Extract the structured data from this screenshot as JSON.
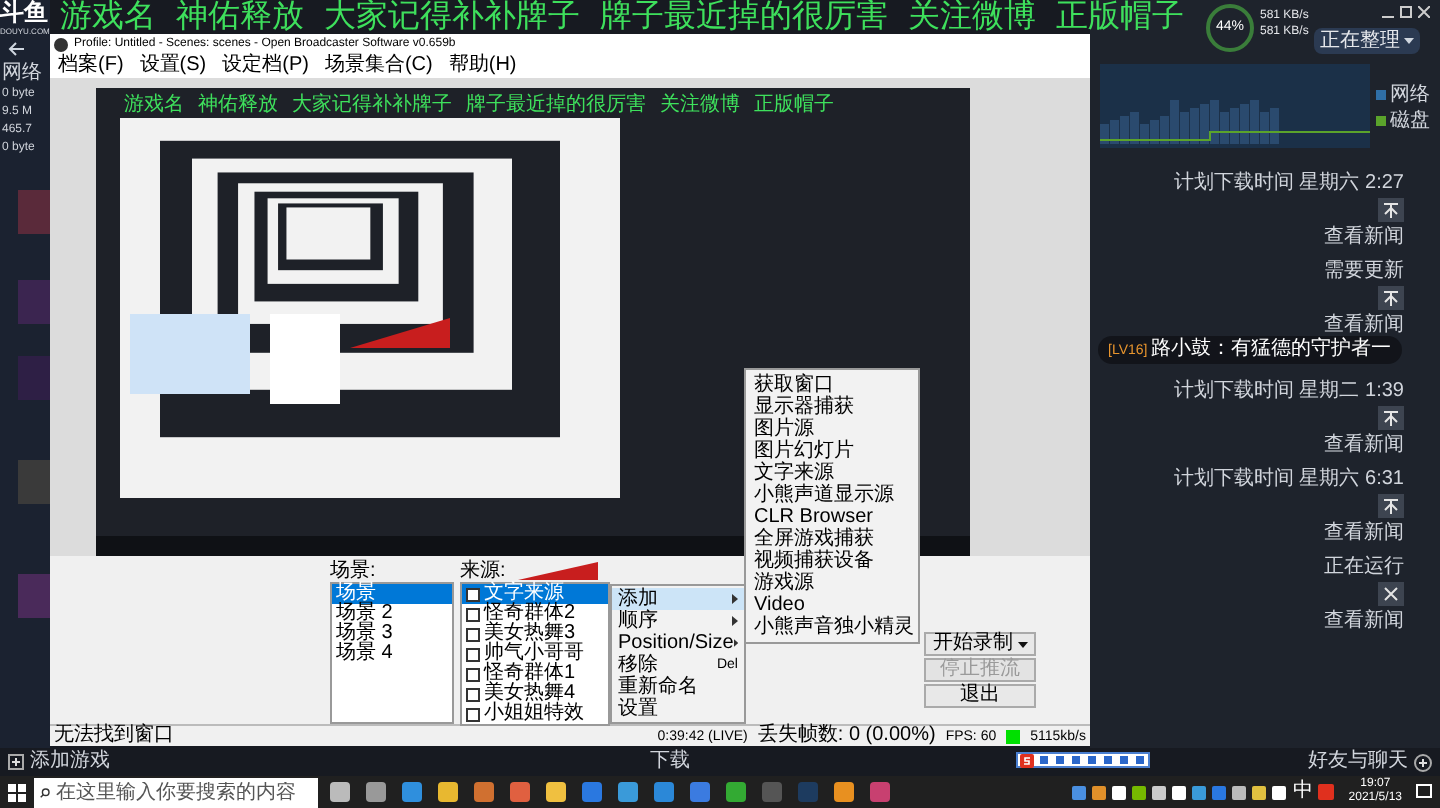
{
  "overlay_lines": [
    {
      "segments": [
        "游戏名",
        "神佑释放",
        "大家记得补补牌子",
        "牌子最近掉的很厉害",
        "关注微博",
        "正版帽子"
      ]
    },
    {
      "segments": [
        "游戏名",
        "神佑释放",
        "大家记得补补牌子",
        "牌子最近掉的很厉害",
        "关注微博",
        "正版帽子"
      ]
    }
  ],
  "steam": {
    "logo": "斗鱼",
    "logo_sub": "DOUYU.COM",
    "stats": [
      "网络",
      "0 byte",
      "9.5 M",
      "465.7",
      "0 byte"
    ],
    "gauge": "44%",
    "rates": [
      "581 KB/s",
      "581 KB/s"
    ],
    "dropdown": "正在整理",
    "legend": [
      {
        "label": "网络",
        "color": "#2f6ea5"
      },
      {
        "label": "磁盘",
        "color": "#5ba32b"
      }
    ],
    "items": [
      {
        "status": "计划下载时间 星期六 2:27",
        "kind": "download",
        "link": "查看新闻"
      },
      {
        "status": "需要更新",
        "kind": "download",
        "link": "查看新闻"
      },
      {
        "status": "计划下载时间 星期二 1:39",
        "kind": "download",
        "link": "查看新闻"
      },
      {
        "status": "计划下载时间 星期六 6:31",
        "kind": "download",
        "link": "查看新闻"
      },
      {
        "status": "正在运行",
        "kind": "stop",
        "link": "查看新闻"
      }
    ],
    "add_game": "添加游戏",
    "downloads": "下载",
    "friends": "好友与聊天"
  },
  "chat": {
    "badge": "[LV16]",
    "text": "路小鼓：有猛德的守护者一"
  },
  "obs": {
    "title": "Profile: Untitled - Scenes: scenes - Open Broadcaster Software v0.659b",
    "menu": [
      "档案(F)",
      "设置(S)",
      "设定档(P)",
      "场景集合(C)",
      "帮助(H)"
    ],
    "scenes_label": "场景:",
    "scenes": [
      {
        "name": "场景",
        "selected": true
      },
      {
        "name": "场景 2",
        "selected": false
      },
      {
        "name": "场景 3",
        "selected": false
      },
      {
        "name": "场景 4",
        "selected": false
      }
    ],
    "sources_label": "来源:",
    "sources": [
      {
        "name": "文字来源",
        "selected": true,
        "checked": false
      },
      {
        "name": "怪奇群体2",
        "selected": false,
        "checked": false
      },
      {
        "name": "美女热舞3",
        "selected": false,
        "checked": false
      },
      {
        "name": "帅气小哥哥",
        "selected": false,
        "checked": false
      },
      {
        "name": "怪奇群体1",
        "selected": false,
        "checked": false
      },
      {
        "name": "美女热舞4",
        "selected": false,
        "checked": false
      },
      {
        "name": "小姐姐特效",
        "selected": false,
        "checked": false
      }
    ],
    "context_menu": [
      {
        "label": "添加",
        "submenu": true,
        "selected": true
      },
      {
        "label": "顺序",
        "submenu": true,
        "selected": false
      },
      {
        "label": "Position/Size",
        "submenu": true,
        "selected": false
      },
      {
        "label": "移除",
        "shortcut": "Del",
        "submenu": false,
        "selected": false
      },
      {
        "label": "重新命名",
        "submenu": false,
        "selected": false
      },
      {
        "label": "设置",
        "submenu": false,
        "selected": false
      }
    ],
    "add_menu": [
      "获取窗口",
      "显示器捕获",
      "图片源",
      "图片幻灯片",
      "文字来源",
      "小熊声道显示源",
      "CLR Browser",
      "全屏游戏捕获",
      "视频捕获设备",
      "游戏源",
      "Video",
      "小熊声音独小精灵"
    ],
    "controls": [
      {
        "label": "开始录制",
        "disabled": false,
        "dropdown": true
      },
      {
        "label": "停止推流",
        "disabled": true,
        "dropdown": false
      },
      {
        "label": "退出",
        "disabled": false,
        "dropdown": false
      }
    ],
    "status": {
      "message": "无法找到窗口",
      "time": "0:39:42 (LIVE)",
      "dropped": "丢失帧数: 0 (0.00%)",
      "fps": "FPS: 60",
      "bitrate": "5115kb/s"
    }
  },
  "taskbar": {
    "search_placeholder": "在这里输入你要搜索的内容",
    "ime": "中",
    "time": "19:07",
    "date": "2021/5/13"
  }
}
